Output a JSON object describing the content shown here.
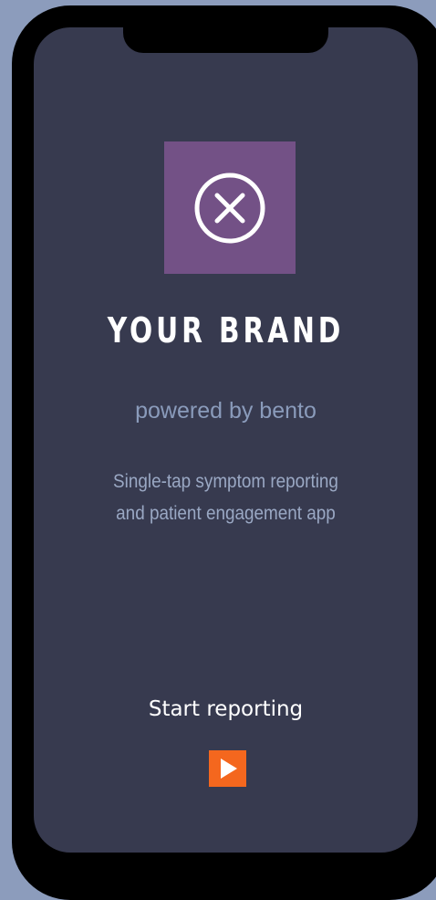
{
  "branding": {
    "title": "YOUR BRAND",
    "powered_by": "powered by bento",
    "logo_icon": "circle-x-icon",
    "logo_color": "#735186"
  },
  "tagline": {
    "line1": "Single-tap symptom reporting",
    "line2": "and patient engagement app"
  },
  "cta": {
    "label": "Start reporting",
    "button_icon": "play-icon",
    "button_color": "#f4671e"
  },
  "colors": {
    "background": "#8c9cbc",
    "screen": "#373a4f",
    "frame": "#000000"
  }
}
